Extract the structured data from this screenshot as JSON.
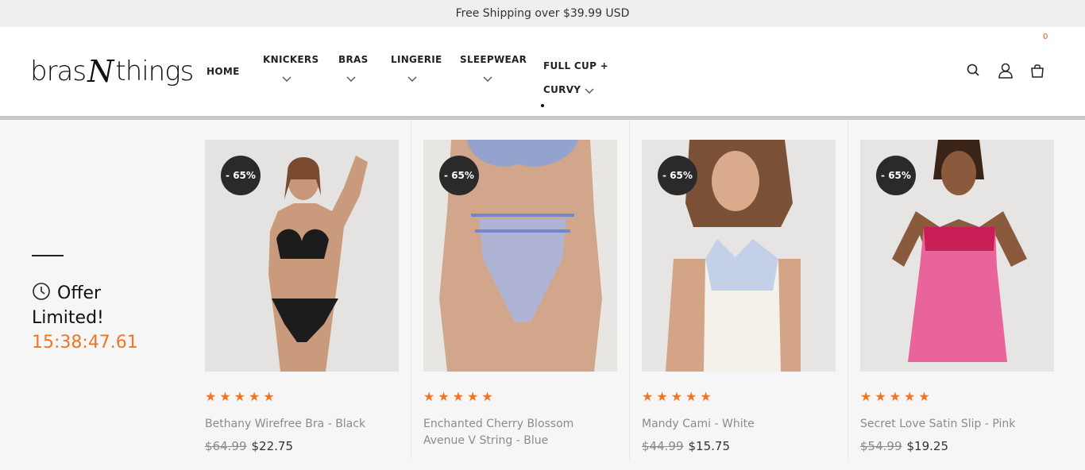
{
  "topbar": {
    "text": "Free Shipping over $39.99 USD"
  },
  "brand": {
    "left": "bras",
    "mid": "N",
    "right": "things"
  },
  "nav": {
    "home": "HOME",
    "items": [
      {
        "label": "KNICKERS"
      },
      {
        "label": "BRAS"
      },
      {
        "label": "LINGERIE"
      },
      {
        "label": "SLEEPWEAR"
      }
    ],
    "full_cup_line1": "FULL CUP +",
    "full_cup_line2": "CURVY"
  },
  "header_icons": [
    "search-icon",
    "user-icon",
    "cart-icon"
  ],
  "cart": {
    "count": "0"
  },
  "offer": {
    "title_line1": "Offer",
    "title_line2": "Limited!",
    "timer": "15:38:47.61"
  },
  "colors": {
    "accent": "#f07522",
    "badge": "#2a2a2a"
  },
  "products": [
    {
      "name": "Bethany Wirefree Bra - Black",
      "discount": "- 65%",
      "rating": "★★★★★",
      "old_price": "$64.99",
      "price": "$22.75"
    },
    {
      "name": "Enchanted Cherry Blossom Avenue V String - Blue",
      "discount": "- 65%",
      "rating": "★★★★★",
      "old_price": "",
      "price": ""
    },
    {
      "name": "Mandy Cami - White",
      "discount": "- 65%",
      "rating": "★★★★★",
      "old_price": "$44.99",
      "price": "$15.75"
    },
    {
      "name": "Secret Love Satin Slip - Pink",
      "discount": "- 65%",
      "rating": "★★★★★",
      "old_price": "$54.99",
      "price": "$19.25"
    }
  ]
}
